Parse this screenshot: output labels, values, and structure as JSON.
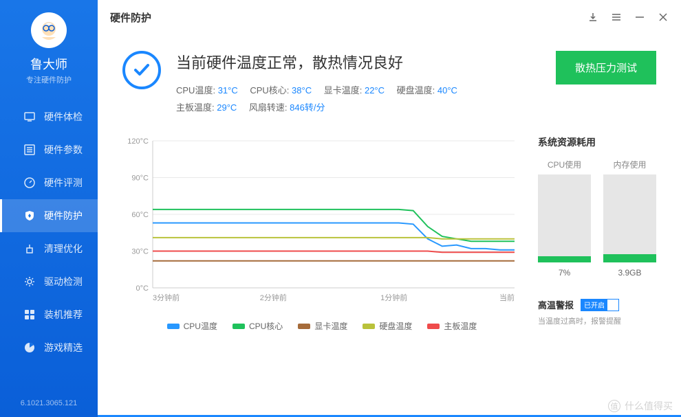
{
  "sidebar": {
    "app_name": "鲁大师",
    "tagline": "专注硬件防护",
    "items": [
      {
        "label": "硬件体检",
        "icon": "monitor-icon"
      },
      {
        "label": "硬件参数",
        "icon": "list-icon"
      },
      {
        "label": "硬件评测",
        "icon": "gauge-icon"
      },
      {
        "label": "硬件防护",
        "icon": "shield-icon",
        "active": true
      },
      {
        "label": "清理优化",
        "icon": "broom-icon"
      },
      {
        "label": "驱动检测",
        "icon": "gear-icon"
      },
      {
        "label": "装机推荐",
        "icon": "grid-icon"
      },
      {
        "label": "游戏精选",
        "icon": "game-icon"
      }
    ],
    "version": "6.1021.3065.121"
  },
  "header": {
    "title": "硬件防护"
  },
  "status": {
    "title": "当前硬件温度正常，散热情况良好",
    "metrics": [
      {
        "label": "CPU温度:",
        "value": "31°C"
      },
      {
        "label": "CPU核心:",
        "value": "38°C"
      },
      {
        "label": "显卡温度:",
        "value": "22°C"
      },
      {
        "label": "硬盘温度:",
        "value": "40°C"
      },
      {
        "label": "主板温度:",
        "value": "29°C"
      },
      {
        "label": "风扇转速:",
        "value": "846转/分"
      }
    ],
    "stress_button": "散热压力测试"
  },
  "chart_data": {
    "type": "line",
    "ylabel": "°C",
    "ylim": [
      0,
      120
    ],
    "y_ticks": [
      "0°C",
      "30°C",
      "60°C",
      "90°C",
      "120°C"
    ],
    "x_ticks": [
      "3分钟前",
      "2分钟前",
      "1分钟前",
      "当前"
    ],
    "series": [
      {
        "name": "CPU温度",
        "color": "#2898ff",
        "values": [
          53,
          53,
          53,
          53,
          53,
          53,
          53,
          53,
          53,
          53,
          53,
          53,
          53,
          53,
          53,
          53,
          53,
          53,
          52,
          40,
          34,
          35,
          32,
          32,
          31,
          31
        ]
      },
      {
        "name": "CPU核心",
        "color": "#1fc15b",
        "values": [
          64,
          64,
          64,
          64,
          64,
          64,
          64,
          64,
          64,
          64,
          64,
          64,
          64,
          64,
          64,
          64,
          64,
          64,
          63,
          50,
          42,
          40,
          38,
          38,
          38,
          38
        ]
      },
      {
        "name": "显卡温度",
        "color": "#a56b3a",
        "values": [
          22,
          22,
          22,
          22,
          22,
          22,
          22,
          22,
          22,
          22,
          22,
          22,
          22,
          22,
          22,
          22,
          22,
          22,
          22,
          22,
          22,
          22,
          22,
          22,
          22,
          22
        ]
      },
      {
        "name": "硬盘温度",
        "color": "#b9c23b",
        "values": [
          41,
          41,
          41,
          41,
          41,
          41,
          41,
          41,
          41,
          41,
          41,
          41,
          41,
          41,
          41,
          41,
          41,
          41,
          41,
          41,
          40,
          40,
          40,
          40,
          40,
          40
        ]
      },
      {
        "name": "主板温度",
        "color": "#ef4b4b",
        "values": [
          30,
          30,
          30,
          30,
          30,
          30,
          30,
          30,
          30,
          30,
          30,
          30,
          30,
          30,
          30,
          30,
          30,
          30,
          30,
          30,
          29,
          29,
          29,
          29,
          29,
          29
        ]
      }
    ]
  },
  "resources": {
    "title": "系统资源耗用",
    "cpu": {
      "label": "CPU使用",
      "value": "7%",
      "fill_pct": 7
    },
    "mem": {
      "label": "内存使用",
      "value": "3.9GB",
      "fill_pct": 10
    }
  },
  "alarm": {
    "label": "高温警报",
    "toggle_text": "已开启",
    "desc": "当温度过高时，报警提醒"
  },
  "watermark": "什么值得买"
}
